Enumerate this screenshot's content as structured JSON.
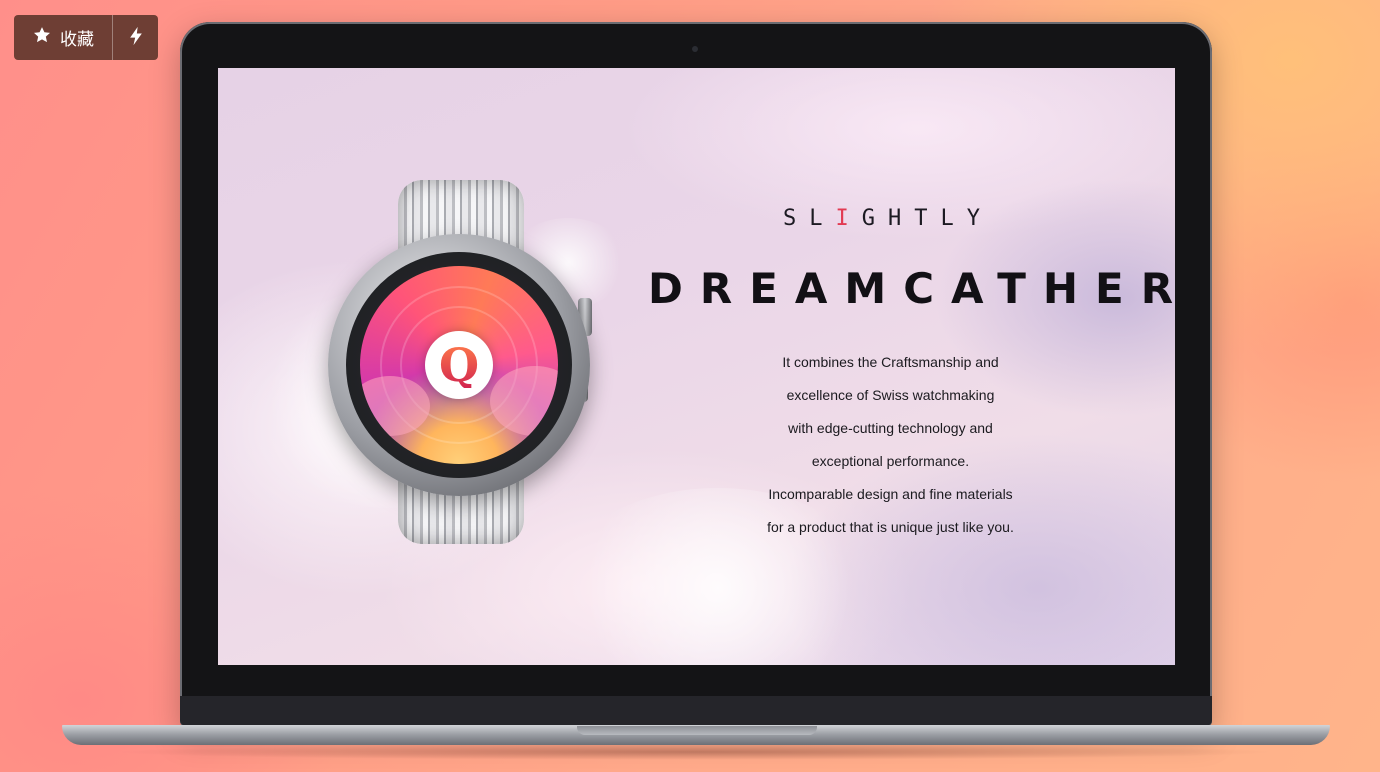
{
  "toolbar": {
    "favorite_label": "收藏",
    "favorite_icon": "star-icon",
    "quick_icon": "bolt-icon",
    "background_color": "#5a3228"
  },
  "screen": {
    "brand": {
      "before": "SL",
      "accent": "I",
      "after": "GHTLY",
      "accent_color": "#e23a52"
    },
    "title": "DREAMCATHER",
    "watch": {
      "dial_letter": "Q"
    },
    "description": [
      "It combines the Craftsmanship and",
      "excellence of Swiss watchmaking",
      "with edge-cutting technology and",
      "exceptional performance.",
      "Incomparable design and fine materials",
      "for a product that is unique just like you."
    ]
  }
}
